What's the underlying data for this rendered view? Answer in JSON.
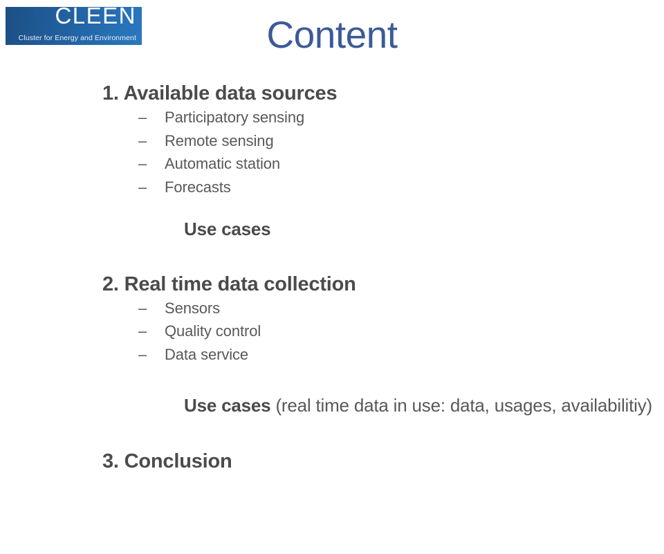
{
  "slide": {
    "title": "Content",
    "title_color": "#3c5a97",
    "background_color": "#ffffff",
    "body_text_color": "#4b4b4b",
    "sub_text_color": "#585858"
  },
  "logo": {
    "wordmark": "CLEEN",
    "tagline": "Cluster for Energy and Environment",
    "gradient_from": "#1c4f84",
    "gradient_to": "#2a78c0",
    "text_color": "#ffffff"
  },
  "outline": {
    "section1": {
      "heading": "1. Available data sources",
      "items": [
        {
          "dash": "–",
          "label": "Participatory sensing"
        },
        {
          "dash": "–",
          "label": "Remote sensing"
        },
        {
          "dash": "–",
          "label": "Automatic station"
        },
        {
          "dash": "–",
          "label": "Forecasts"
        }
      ],
      "use_cases": "Use cases"
    },
    "section2": {
      "heading": "2. Real time data collection",
      "items": [
        {
          "dash": "–",
          "label": "Sensors"
        },
        {
          "dash": "–",
          "label": "Quality control"
        },
        {
          "dash": "–",
          "label": "Data service"
        }
      ],
      "use_cases_bold": "Use cases",
      "use_cases_detail": " (real time data in use: data, usages, availabilitiy)"
    },
    "section3": {
      "heading": "3. Conclusion"
    }
  }
}
